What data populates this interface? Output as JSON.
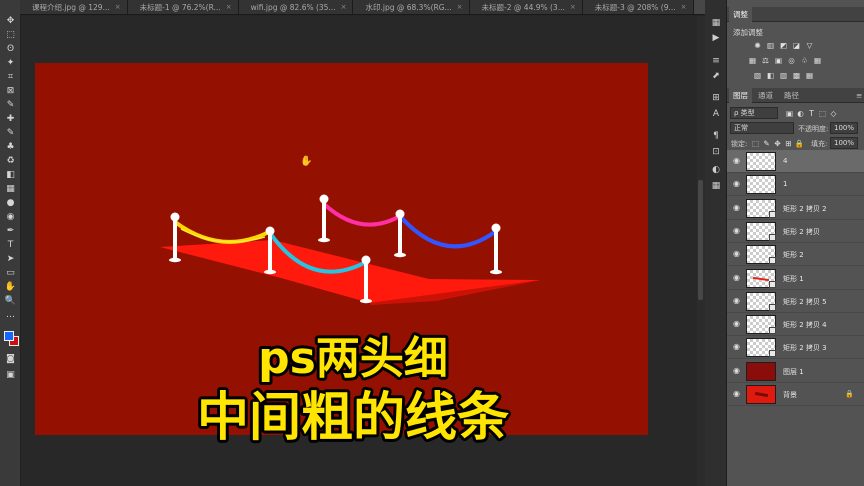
{
  "tabs": [
    {
      "label": "课程介绍.jpg @ 129...",
      "active": false
    },
    {
      "label": "未标题-1 @ 76.2%(R...",
      "active": false
    },
    {
      "label": "wifi.jpg @ 82.6% (35...",
      "active": false
    },
    {
      "label": "水印.jpg @ 68.3%(RG...",
      "active": false
    },
    {
      "label": "未标题-2 @ 44.9% (3...",
      "active": false
    },
    {
      "label": "未标题-3 @ 208% (9...",
      "active": false
    },
    {
      "label": "路径.jpg @ 111% (4, RGB/8#) *",
      "active": true
    }
  ],
  "tab_close_glyph": "×",
  "toolbar": {
    "icons": [
      "move-tool-icon",
      "marquee-tool-icon",
      "lasso-tool-icon",
      "magic-wand-tool-icon",
      "crop-tool-icon",
      "frame-tool-icon",
      "eyedropper-tool-icon",
      "healing-brush-icon",
      "brush-tool-icon",
      "stamp-tool-icon",
      "history-brush-icon",
      "eraser-tool-icon",
      "gradient-tool-icon",
      "blur-tool-icon",
      "dodge-tool-icon",
      "pen-tool-icon",
      "type-tool-icon",
      "path-selection-icon",
      "rectangle-tool-icon",
      "hand-tool-icon",
      "zoom-tool-icon",
      "more-tools-icon"
    ],
    "glyphs": [
      "✥",
      "⬚",
      "ʘ",
      "✦",
      "⌗",
      "⊠",
      "✎",
      "✚",
      "✎",
      "♣",
      "♻",
      "◧",
      "▦",
      "●",
      "◉",
      "✒",
      "T",
      "➤",
      "▭",
      "✋",
      "🔍",
      "…"
    ],
    "colors": {
      "foreground": "#1565ff",
      "background": "#cc0f0f"
    }
  },
  "right_strip_icons": [
    "history-icon",
    "play-icon",
    "brush-settings-icon",
    "clone-source-icon",
    "paths-icon",
    "character-icon",
    "paragraph-icon",
    "glyphs-icon",
    "color-icon",
    "swatches-icon"
  ],
  "right_strip_glyphs": [
    "▦",
    "▶",
    "≡",
    "⬈",
    "⊞",
    "A",
    "¶",
    "⊡",
    "◐",
    "▦"
  ],
  "adjustments": {
    "panel_title": "调整",
    "subtitle": "添加调整",
    "row1": [
      "✺",
      "▥",
      "◩",
      "◪",
      "▽"
    ],
    "row2": [
      "▦",
      "⚖",
      "▣",
      "◎",
      "♧",
      "▦"
    ],
    "row3": [
      "▧",
      "◧",
      "▨",
      "▩",
      "▦"
    ]
  },
  "layers_panel": {
    "tabs": [
      "图层",
      "通道",
      "路径"
    ],
    "kind_filter": "ρ 类型",
    "filter_icons": [
      "▣",
      "◐",
      "T",
      "⬚",
      "◇"
    ],
    "blend_mode": "正常",
    "opacity_label": "不透明度:",
    "opacity_value": "100%",
    "lock_label": "锁定:",
    "lock_icons": [
      "⬚",
      "✎",
      "✥",
      "⊞",
      "🔒"
    ],
    "fill_label": "填充:",
    "fill_value": "100%",
    "visibility_glyph": "◉",
    "lock_glyph": "🔒",
    "layers": [
      {
        "name": "4",
        "thumb": "transparent",
        "selected": true,
        "linked": false
      },
      {
        "name": "1",
        "thumb": "transparent",
        "selected": false,
        "linked": false
      },
      {
        "name": "矩形 2 拷贝 2",
        "thumb": "transparent",
        "selected": false,
        "linked": true
      },
      {
        "name": "矩形 2 拷贝",
        "thumb": "transparent",
        "selected": false,
        "linked": true
      },
      {
        "name": "矩形 2",
        "thumb": "transparent",
        "selected": false,
        "linked": true
      },
      {
        "name": "矩形 1",
        "thumb": "stroke",
        "selected": false,
        "linked": true
      },
      {
        "name": "矩形 2 拷贝 5",
        "thumb": "transparent",
        "selected": false,
        "linked": true
      },
      {
        "name": "矩形 2 拷贝 4",
        "thumb": "transparent",
        "selected": false,
        "linked": true
      },
      {
        "name": "矩形 2 拷贝 3",
        "thumb": "transparent",
        "selected": false,
        "linked": true
      },
      {
        "name": "图层 1",
        "thumb": "red",
        "selected": false,
        "linked": false
      },
      {
        "name": "背景",
        "thumb": "bright",
        "selected": false,
        "linked": false,
        "locked": true
      }
    ]
  },
  "document": {
    "background_color": "#941000",
    "carpet_color": "#ff1a0d",
    "rope_colors": [
      "#ffd600",
      "#29c3e0",
      "#ff2fa5",
      "#3355ff"
    ],
    "caption_line1": "ps两头细",
    "caption_line2": "中间粗的线条",
    "caption_color": "#ffe500"
  }
}
